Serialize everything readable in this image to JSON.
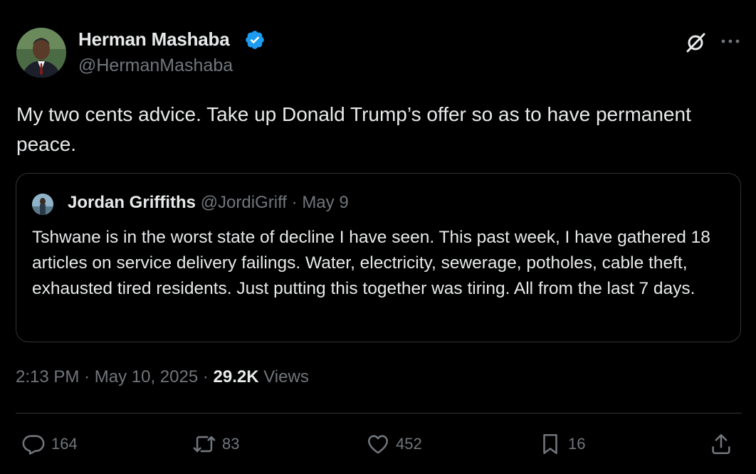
{
  "author": {
    "name": "Herman Mashaba",
    "handle": "@HermanMashaba"
  },
  "tweet": {
    "text": "My two cents advice. Take up Donald Trump’s offer so as to have permanent peace."
  },
  "quoted": {
    "name": "Jordan Griffiths",
    "handle": "@JordiGriff",
    "separator": "·",
    "date": "May 9",
    "text": "Tshwane is in the worst state of decline I have seen. This past week, I have gathered 18 articles on service delivery failings. Water, electricity, sewerage, potholes, cable theft, exhausted tired residents. Just putting this together was tiring. All from the last 7 days."
  },
  "meta": {
    "time": "2:13 PM",
    "dot1": "·",
    "date": "May 10, 2025",
    "dot2": "·",
    "views_count": "29.2K",
    "views_label": "Views"
  },
  "actions": {
    "replies": "164",
    "reposts": "83",
    "likes": "452",
    "bookmarks": "16"
  },
  "colors": {
    "background": "#000000",
    "text": "#e7e9ea",
    "muted": "#71767b",
    "border": "#2f3336",
    "verified": "#1d9bf0"
  }
}
